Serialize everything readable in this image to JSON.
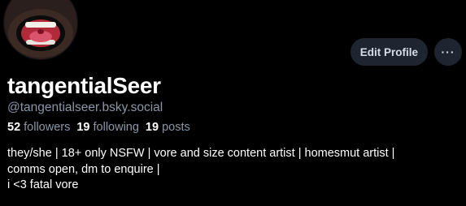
{
  "profile": {
    "display_name": "tangentialSeer",
    "handle": "@tangentialseer.bsky.social"
  },
  "actions": {
    "edit_label": "Edit Profile",
    "more_label": "···"
  },
  "stats": {
    "followers_count": "52",
    "followers_label": "followers",
    "following_count": "19",
    "following_label": "following",
    "posts_count": "19",
    "posts_label": "posts"
  },
  "bio": {
    "line1": "they/she | 18+ only NSFW | vore and size content artist | homesmut artist |",
    "line2": "comms open, dm to enquire |",
    "line3": "i <3 fatal vore"
  },
  "colors": {
    "background": "#000000",
    "button_bg": "#1e2530",
    "muted_text": "#8a96a6"
  }
}
